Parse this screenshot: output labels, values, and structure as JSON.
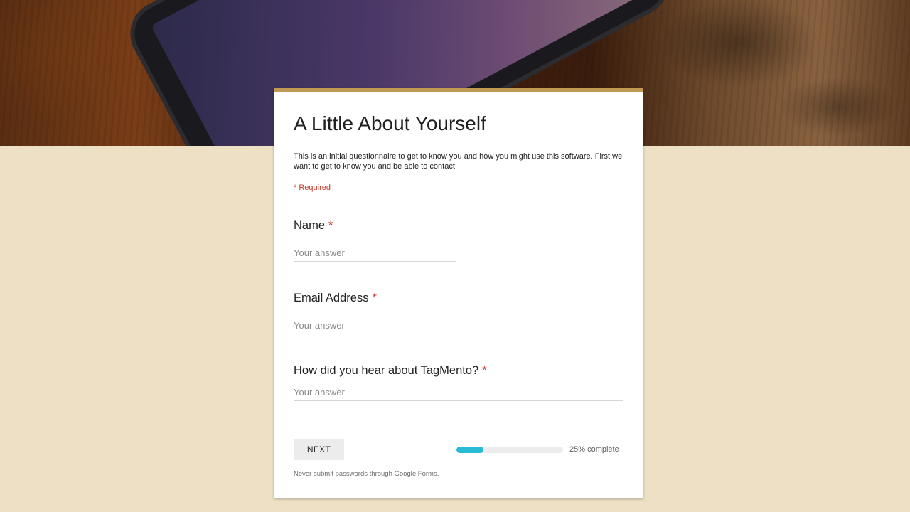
{
  "form": {
    "title": "A Little About Yourself",
    "description": "This is an initial questionnaire to get to know you and how you might use this software. First we want to get to know you and be able to contact",
    "required_note": "* Required",
    "accent_color": "#c09a52",
    "questions": [
      {
        "label": "Name",
        "required_mark": "*",
        "placeholder": "Your answer",
        "value": ""
      },
      {
        "label": "Email Address",
        "required_mark": "*",
        "placeholder": "Your answer",
        "value": ""
      },
      {
        "label": "How did you hear about TagMento?",
        "required_mark": "*",
        "placeholder": "Your answer",
        "value": ""
      }
    ],
    "next_label": "NEXT",
    "progress": {
      "fraction": 0.25,
      "label": "25% complete",
      "color": "#27bcd4"
    },
    "footer_note": "Never submit passwords through Google Forms."
  }
}
